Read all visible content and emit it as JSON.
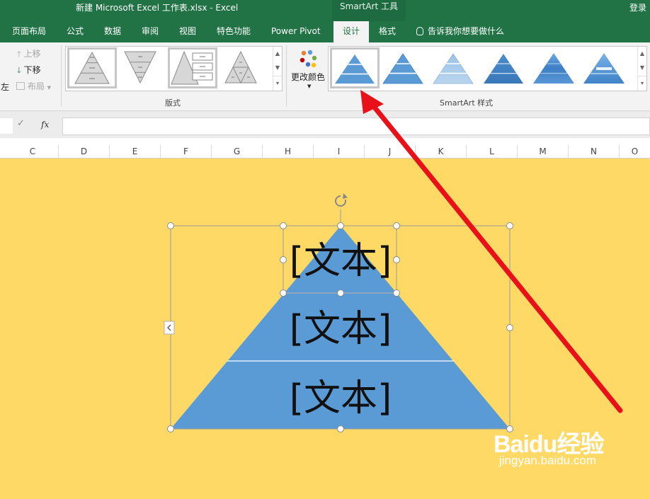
{
  "window": {
    "title": "新建 Microsoft Excel 工作表.xlsx  -  Excel",
    "context_tools": "SmartArt 工具",
    "login": "登录"
  },
  "tabs": [
    {
      "label": "页面布局",
      "active": false
    },
    {
      "label": "公式",
      "active": false
    },
    {
      "label": "数据",
      "active": false
    },
    {
      "label": "审阅",
      "active": false
    },
    {
      "label": "视图",
      "active": false
    },
    {
      "label": "特色功能",
      "active": false
    },
    {
      "label": "Power Pivot",
      "active": false
    },
    {
      "label": "设计",
      "active": true
    },
    {
      "label": "格式",
      "active": false
    }
  ],
  "tell_me": "告诉我你想要做什么",
  "ribbon": {
    "left_partial": "左",
    "move_up": "上移",
    "move_down": "下移",
    "layout_btn": "布局",
    "group_layouts": "版式",
    "change_colors": "更改颜色",
    "group_styles": "SmartArt 样式"
  },
  "formula_bar": {
    "cancel_icon": "✓",
    "fx": "fx",
    "value": ""
  },
  "columns": [
    "C",
    "D",
    "E",
    "F",
    "G",
    "H",
    "I",
    "J",
    "K",
    "L",
    "M",
    "N",
    "O"
  ],
  "smartart": {
    "texts": [
      "[文本]",
      "[文本]",
      "[文本]"
    ],
    "fill_color": "#5b9bd5",
    "sheet_color": "#ffd966"
  },
  "watermark": {
    "main": "Baidu经验",
    "sub": "jingyan.baidu.com"
  },
  "colors": {
    "accent": "#217346",
    "arrow": "#e8111a"
  }
}
